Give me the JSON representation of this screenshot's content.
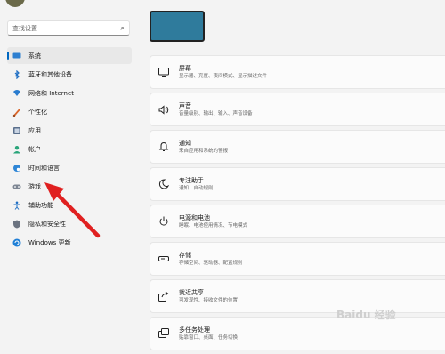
{
  "search": {
    "placeholder": "查找设置"
  },
  "nav": [
    {
      "label": "系统",
      "icon": "monitor-icon"
    },
    {
      "label": "蓝牙和其他设备",
      "icon": "bluetooth-icon"
    },
    {
      "label": "网络和 Internet",
      "icon": "wifi-icon"
    },
    {
      "label": "个性化",
      "icon": "brush-icon"
    },
    {
      "label": "应用",
      "icon": "apps-icon"
    },
    {
      "label": "帐户",
      "icon": "account-icon"
    },
    {
      "label": "时间和语言",
      "icon": "globe-clock-icon"
    },
    {
      "label": "游戏",
      "icon": "gamepad-icon"
    },
    {
      "label": "辅助功能",
      "icon": "accessibility-icon"
    },
    {
      "label": "隐私和安全性",
      "icon": "shield-icon"
    },
    {
      "label": "Windows 更新",
      "icon": "update-icon"
    }
  ],
  "cards": [
    {
      "title": "屏幕",
      "subtitle": "显示器、亮度、夜间模式、显示描述文件",
      "icon": "display-icon"
    },
    {
      "title": "声音",
      "subtitle": "音量级别、输出、输入、声音设备",
      "icon": "speaker-icon"
    },
    {
      "title": "通知",
      "subtitle": "来自应用和系统的警报",
      "icon": "bell-icon"
    },
    {
      "title": "专注助手",
      "subtitle": "通知、自动规则",
      "icon": "moon-icon"
    },
    {
      "title": "电源和电池",
      "subtitle": "睡眠、电池使用情况、节电模式",
      "icon": "power-icon"
    },
    {
      "title": "存储",
      "subtitle": "存储空间、驱动器、配置规则",
      "icon": "storage-icon"
    },
    {
      "title": "就近共享",
      "subtitle": "可发现性、接收文件的位置",
      "icon": "share-icon"
    },
    {
      "title": "多任务处理",
      "subtitle": "贴靠窗口、桌面、任务切换",
      "icon": "multitask-icon"
    }
  ],
  "watermark": "Baidu 经验",
  "colors": {
    "accent": "#0067c0",
    "annotation_arrow": "#e02020"
  }
}
